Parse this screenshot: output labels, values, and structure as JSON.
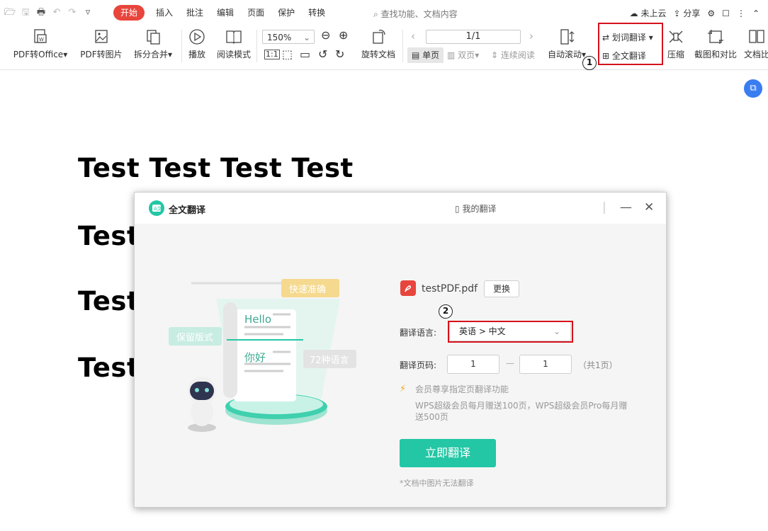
{
  "quick_access": {
    "icons": [
      "open-folder-icon",
      "save-icon",
      "print-icon",
      "undo-icon",
      "redo-icon",
      "dropdown-icon"
    ]
  },
  "menu": {
    "tabs": [
      "开始",
      "插入",
      "批注",
      "编辑",
      "页面",
      "保护",
      "转换"
    ]
  },
  "search": {
    "placeholder": "查找功能、文档内容"
  },
  "header_right": {
    "cloud": "未上云",
    "share": "分享"
  },
  "ribbon": {
    "pdf_to_office": "PDF转Office",
    "pdf_to_image": "PDF转图片",
    "split_merge": "拆分合并",
    "play": "播放",
    "read_mode": "阅读模式",
    "zoom": "150%",
    "rotate": "旋转文档",
    "page_value": "1/1",
    "single_page": "单页",
    "double_page": "双页",
    "continuous": "连续阅读",
    "auto_scroll": "自动滚动",
    "word_translate": "划词翻译",
    "full_translate": "全文翻译",
    "compress": "压缩",
    "screenshot_compare": "截图和对比",
    "doc_compare": "文档比"
  },
  "annotations": {
    "one": "1",
    "two": "2"
  },
  "document": {
    "lines": [
      "Test Test Test Test",
      "Test",
      "Test",
      "Test"
    ]
  },
  "dialog": {
    "title": "全文翻译",
    "my_translations": "我的翻译",
    "illustration": {
      "bubble_fast": "快速准确",
      "bubble_layout": "保留版式",
      "bubble_langs": "72种语言",
      "hello": "Hello",
      "nihao": "你好"
    },
    "file_name": "testPDF.pdf",
    "change_btn": "更换",
    "lang_label": "翻译语言:",
    "lang_value": "英语 > 中文",
    "page_label": "翻译页码:",
    "page_from": "1",
    "page_to": "1",
    "page_dash": "—",
    "page_total": "（共1页）",
    "vip_title": "会员尊享指定页翻译功能",
    "vip_desc_1": "WPS超级会员每月赠送100页，WPS超级会员Pro每月赠",
    "vip_desc_2": "送500页",
    "translate_btn": "立即翻译",
    "footnote": "*文档中图片无法翻译"
  },
  "colors": {
    "accent_red": "#e8453c",
    "teal": "#23c7a5",
    "highlight": "#d5121c"
  }
}
